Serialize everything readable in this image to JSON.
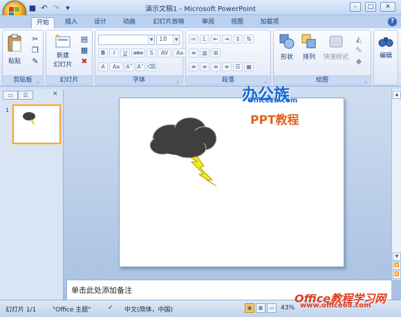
{
  "window": {
    "title": "演示文稿1 - Microsoft PowerPoint"
  },
  "quick_access": {
    "icons": [
      "save-icon",
      "undo-icon",
      "redo-icon",
      "customize-icon"
    ]
  },
  "tabs": [
    "开始",
    "插入",
    "设计",
    "动画",
    "幻灯片放映",
    "审阅",
    "视图",
    "加载项"
  ],
  "active_tab": "开始",
  "ribbon": {
    "clipboard": {
      "label": "剪贴板",
      "paste": "粘贴"
    },
    "slides": {
      "label": "幻灯片",
      "new_slide_line1": "新建",
      "new_slide_line2": "幻灯片"
    },
    "font": {
      "label": "字体",
      "font_name": "",
      "font_size": "18"
    },
    "paragraph": {
      "label": "段落"
    },
    "drawing": {
      "label": "绘图",
      "shapes": "形状",
      "arrange": "排列",
      "quick_styles": "快速样式"
    },
    "editing": {
      "label": "编辑"
    }
  },
  "notes": {
    "placeholder": "单击此处添加备注"
  },
  "status": {
    "slide": "幻灯片 1/1",
    "theme": "\"Office 主题\"",
    "language": "中文(简体，中国)",
    "zoom": "43%"
  },
  "thumbnail": {
    "number": "1"
  },
  "watermark": {
    "brand_cn": "办公族",
    "brand_url": "Officezu.com",
    "subtitle": "PPT教程",
    "site_cn": "Office教程学习网",
    "site_url": "www.office68.com"
  },
  "colors": {
    "accent": "#f3a447",
    "cloud": "#3f3f3f",
    "bolt": "#f3ea1c",
    "ribbon_bg": "#dfe9f7"
  }
}
